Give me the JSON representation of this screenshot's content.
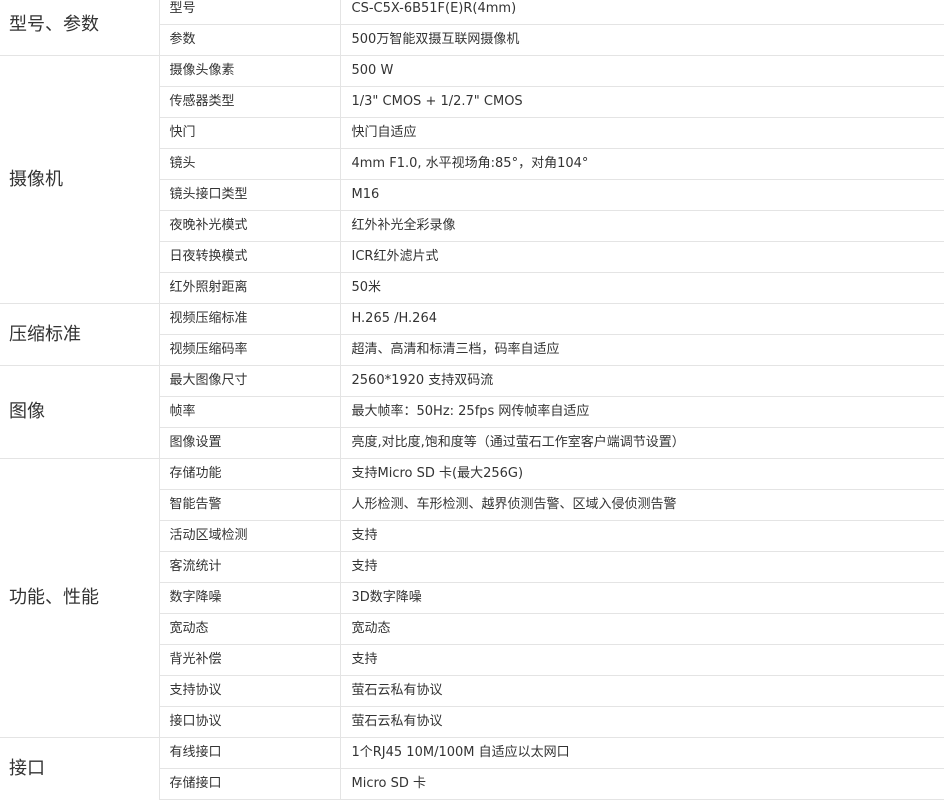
{
  "groups": [
    {
      "category": "型号、参数",
      "rows": [
        {
          "label": "型号",
          "value": "CS-C5X-6B51F(E)R(4mm)"
        },
        {
          "label": "参数",
          "value": "500万智能双摄互联网摄像机"
        }
      ]
    },
    {
      "category": "摄像机",
      "rows": [
        {
          "label": "摄像头像素",
          "value": "500 W"
        },
        {
          "label": "传感器类型",
          "value": "1/3\" CMOS + 1/2.7\" CMOS"
        },
        {
          "label": "快门",
          "value": "快门自适应"
        },
        {
          "label": "镜头",
          "value": "4mm F1.0, 水平视场角:85°，对角104°"
        },
        {
          "label": "镜头接口类型",
          "value": "M16"
        },
        {
          "label": "夜晚补光模式",
          "value": "红外补光全彩录像"
        },
        {
          "label": "日夜转换模式",
          "value": "ICR红外滤片式"
        },
        {
          "label": "红外照射距离",
          "value": "50米"
        }
      ]
    },
    {
      "category": "压缩标准",
      "rows": [
        {
          "label": "视频压缩标准",
          "value": "H.265 /H.264"
        },
        {
          "label": "视频压缩码率",
          "value": "超清、高清和标清三档，码率自适应"
        }
      ]
    },
    {
      "category": "图像",
      "rows": [
        {
          "label": "最大图像尺寸",
          "value": "2560*1920 支持双码流"
        },
        {
          "label": "帧率",
          "value": "最大帧率：50Hz: 25fps 网传帧率自适应"
        },
        {
          "label": "图像设置",
          "value": "亮度,对比度,饱和度等（通过萤石工作室客户端调节设置）"
        }
      ]
    },
    {
      "category": "功能、性能",
      "rows": [
        {
          "label": "存储功能",
          "value": "支持Micro SD 卡(最大256G)"
        },
        {
          "label": "智能告警",
          "value": "人形检测、车形检测、越界侦测告警、区域入侵侦测告警"
        },
        {
          "label": "活动区域检测",
          "value": "支持"
        },
        {
          "label": "客流统计",
          "value": "支持"
        },
        {
          "label": "数字降噪",
          "value": "3D数字降噪"
        },
        {
          "label": "宽动态",
          "value": "宽动态"
        },
        {
          "label": "背光补偿",
          "value": "支持"
        },
        {
          "label": "支持协议",
          "value": "萤石云私有协议"
        },
        {
          "label": "接口协议",
          "value": "萤石云私有协议"
        }
      ]
    },
    {
      "category": "接口",
      "rows": [
        {
          "label": "有线接口",
          "value": "1个RJ45 10M/100M 自适应以太网口"
        },
        {
          "label": "存储接口",
          "value": "Micro SD 卡"
        }
      ]
    }
  ]
}
